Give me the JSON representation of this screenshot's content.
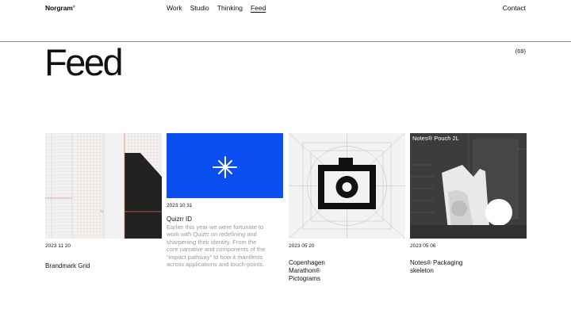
{
  "header": {
    "logo": "Norgram",
    "logo_mark": "®",
    "nav": [
      "Work",
      "Studio",
      "Thinking",
      "Feed"
    ],
    "active_nav": "Feed",
    "contact": "Contact"
  },
  "page": {
    "title": "Feed",
    "count": "(69)"
  },
  "cards": [
    {
      "date": "2023 11 20",
      "title": "Brandmark Grid"
    },
    {
      "date": "2023 10 31",
      "title": "Quizrr ID",
      "description": "Earlier this year we were fortunate to work with Quizrr on redefining and sharpening their identity. From the core narrative and components of the “impact pathway” to how it manifests across applications and touch-points."
    },
    {
      "date": "2023 05 20",
      "title": "Copenhagen Marathon® Pictograms"
    },
    {
      "date": "2023 05 06",
      "title": "Notes® Packaging skeleton",
      "image_label": "Notes® Pouch 2L"
    }
  ],
  "colors": {
    "accent_blue": "#0a4ff2",
    "grid_red": "#e86a4f",
    "dark_panel": "#3a3d39"
  }
}
